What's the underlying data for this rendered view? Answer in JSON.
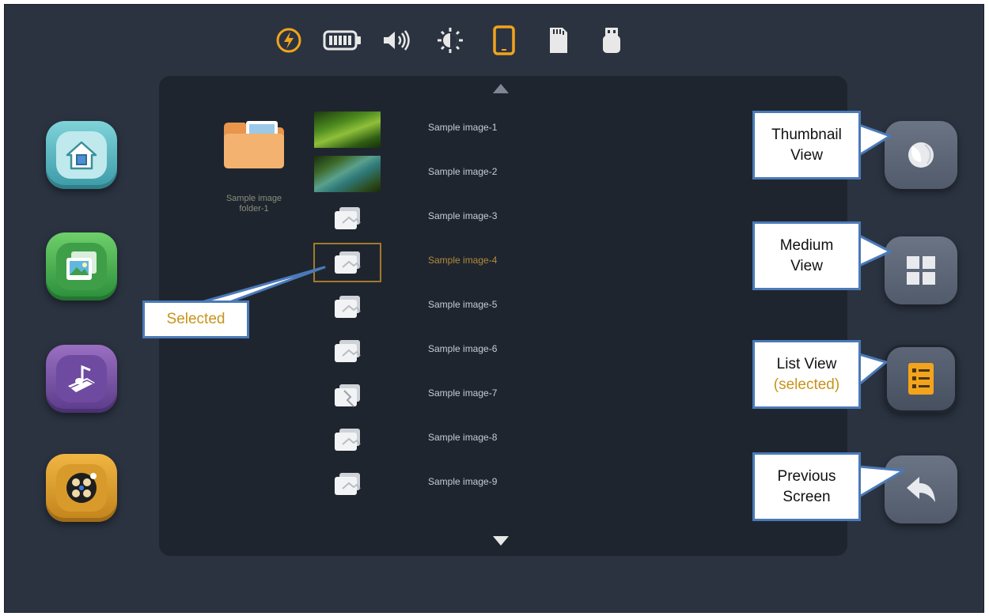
{
  "status_bar": {
    "icons": [
      "power-icon",
      "battery-icon",
      "volume-icon",
      "brightness-icon",
      "tablet-icon",
      "sd-card-icon",
      "usb-drive-icon"
    ],
    "active_icon": "tablet-icon",
    "accent_color": "#f2a41c"
  },
  "apps": [
    "home-app-icon",
    "photo-app-icon",
    "music-app-icon",
    "video-app-icon"
  ],
  "browser": {
    "folder": {
      "label": "Sample image\nfolder-1"
    },
    "files": [
      {
        "name": "Sample image-1",
        "thumb": "photo"
      },
      {
        "name": "Sample image-2",
        "thumb": "photo"
      },
      {
        "name": "Sample image-3",
        "thumb": "generic"
      },
      {
        "name": "Sample image-4",
        "thumb": "generic",
        "selected": true
      },
      {
        "name": "Sample image-5",
        "thumb": "generic"
      },
      {
        "name": "Sample image-6",
        "thumb": "generic"
      },
      {
        "name": "Sample image-7",
        "thumb": "broken"
      },
      {
        "name": "Sample image-8",
        "thumb": "generic"
      },
      {
        "name": "Sample image-9",
        "thumb": "generic"
      }
    ]
  },
  "view_buttons": [
    "thumbnail-view-icon",
    "medium-view-icon",
    "list-view-icon",
    "previous-screen-icon"
  ],
  "callouts": {
    "selected": "Selected",
    "thumbnail": {
      "line1": "Thumbnail",
      "line2": "View"
    },
    "medium": {
      "line1": "Medium",
      "line2": "View"
    },
    "list": {
      "line1": "List View",
      "line2": "(selected)"
    },
    "previous": {
      "line1": "Previous",
      "line2": "Screen"
    }
  }
}
